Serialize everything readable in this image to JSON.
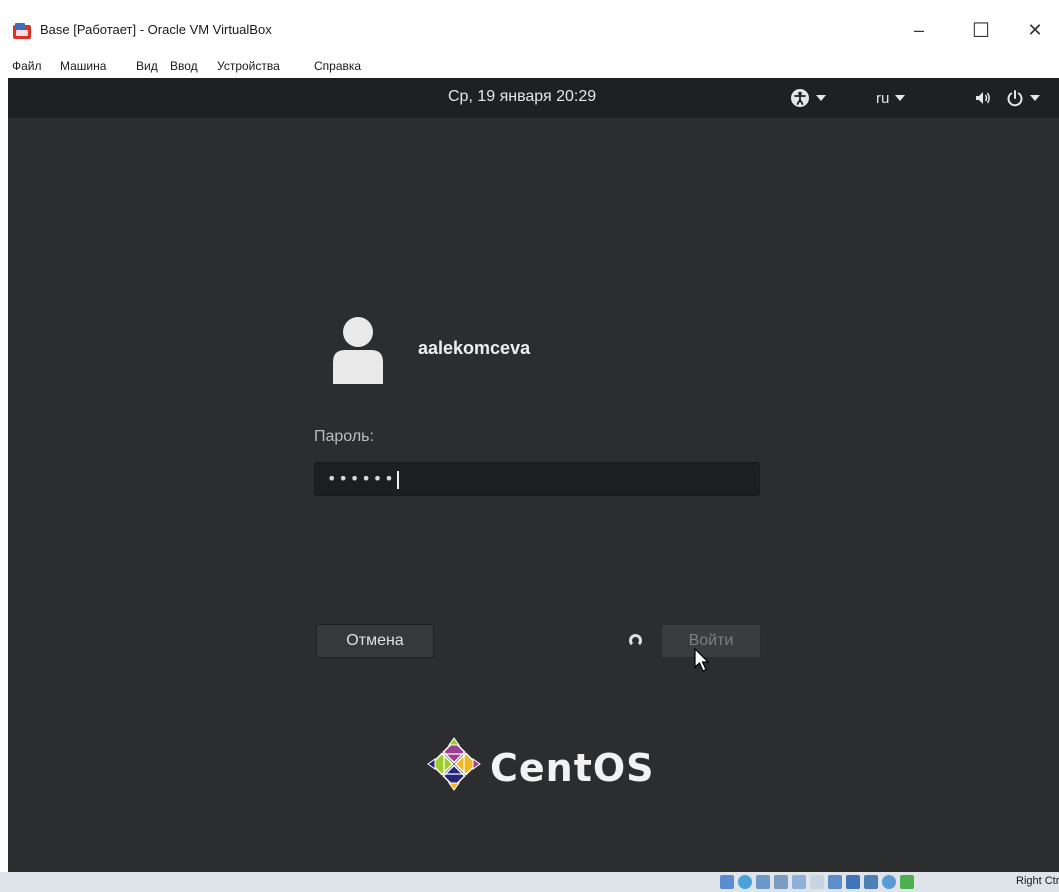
{
  "window": {
    "title": "Base [Работает] - Oracle VM VirtualBox",
    "minimize_symbol": "–",
    "maximize_symbol": "☐",
    "close_symbol": "✕"
  },
  "menu": {
    "items": [
      "Файл",
      "Машина",
      "Вид",
      "Ввод",
      "Устройства",
      "Справка"
    ]
  },
  "gnome_topbar": {
    "clock": "Ср, 19 января  20:29",
    "language": "ru",
    "icons": [
      "accessibility-icon",
      "volume-icon",
      "power-icon"
    ]
  },
  "login": {
    "username": "aalekomceva",
    "password_label": "Пароль:",
    "password_masked": "••••••",
    "cancel_label": "Отмена",
    "login_label": "Войти"
  },
  "branding": {
    "logo_text": "CentOS"
  },
  "statusbar": {
    "host_key": "Right Ctrl",
    "icons": [
      "hdd-icon",
      "optical-icon",
      "audio-icon",
      "network-icon",
      "usb-icon",
      "shared-folders-icon",
      "display-icon",
      "recording-icon",
      "cpu-icon",
      "mouse-integration-icon",
      "host-key-icon"
    ]
  },
  "colors": {
    "vm_background": "#2b2d2f",
    "topbar": "#1f2022",
    "statusbar": "#dfe4ea",
    "centos_purple": "#9c3e91",
    "centos_yellow": "#f0b624",
    "centos_green": "#9ccd2a",
    "centos_blue": "#262577"
  }
}
